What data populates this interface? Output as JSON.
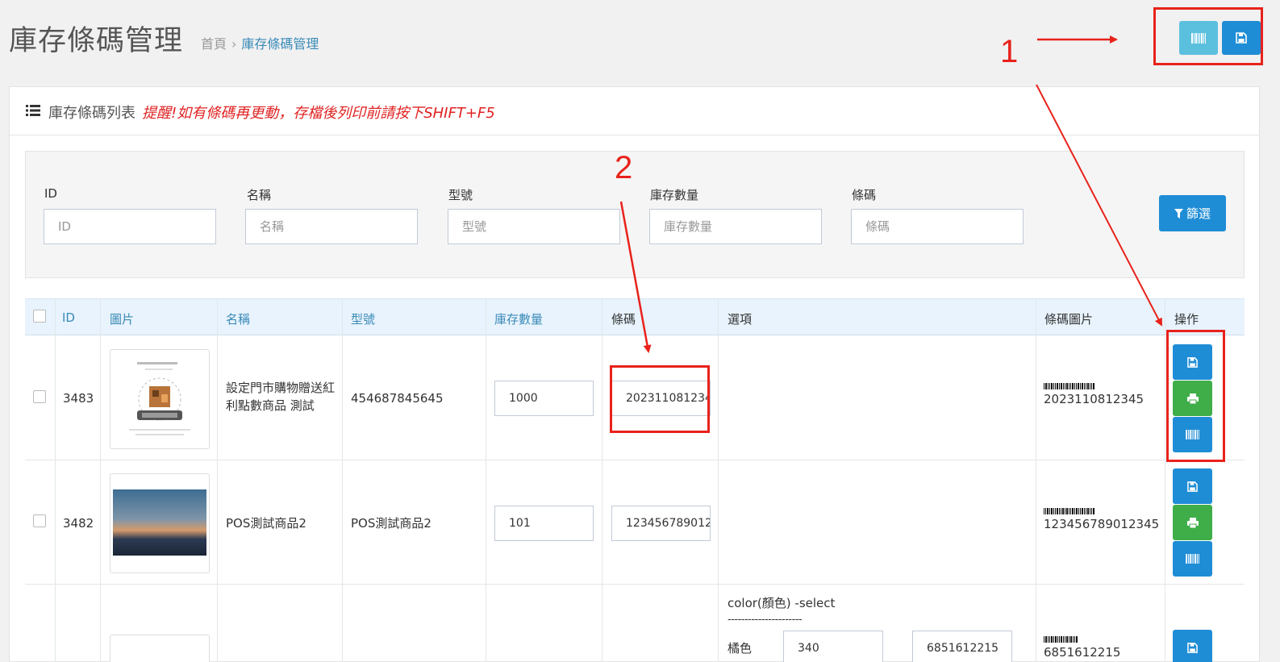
{
  "header": {
    "title": "庫存條碼管理",
    "breadcrumb": {
      "home": "首頁",
      "separator": "›",
      "current": "庫存條碼管理"
    }
  },
  "annotations": {
    "one": "1",
    "two": "2",
    "color": "#e8221b"
  },
  "portlet": {
    "caption": "庫存條碼列表",
    "warning": "提醒!如有條碼再更動，存檔後列印前請按下SHIFT+F5"
  },
  "filters": {
    "fields": [
      {
        "label": "ID",
        "placeholder": "ID"
      },
      {
        "label": "名稱",
        "placeholder": "名稱"
      },
      {
        "label": "型號",
        "placeholder": "型號"
      },
      {
        "label": "庫存數量",
        "placeholder": "庫存數量"
      },
      {
        "label": "條碼",
        "placeholder": "條碼"
      }
    ],
    "button_label": "篩選"
  },
  "table": {
    "columns": [
      "ID",
      "圖片",
      "名稱",
      "型號",
      "庫存數量",
      "條碼",
      "選項",
      "條碼圖片",
      "操作"
    ],
    "rows": [
      {
        "id": "3483",
        "name": "設定門市購物贈送紅利點數商品 測試",
        "model": "454687845645",
        "stock": "1000",
        "barcode": "2023110812345",
        "barcode_text": "2023110812345",
        "image": "product-flyer-image"
      },
      {
        "id": "3482",
        "name": "POS測試商品2",
        "model": "POS測試商品2",
        "stock": "101",
        "barcode": "123456789012345",
        "barcode_text": "123456789012345",
        "image": "sunset-landscape-image"
      },
      {
        "id": "",
        "name": "",
        "model": "",
        "stock": "",
        "barcode": "",
        "barcode_text": "6851612215",
        "options": {
          "title": "color(顏色) -select",
          "divider": "----------------------",
          "label": "橘色",
          "stock": "340",
          "barcode": "6851612215"
        }
      }
    ]
  },
  "colors": {
    "primary": "#1f8dd6",
    "info": "#5bc0de",
    "success": "#3fae49",
    "link": "#3a8ab7",
    "danger": "#e02222"
  },
  "icons": [
    "barcode-icon",
    "save-icon",
    "print-icon",
    "filter-icon",
    "list-icon"
  ]
}
